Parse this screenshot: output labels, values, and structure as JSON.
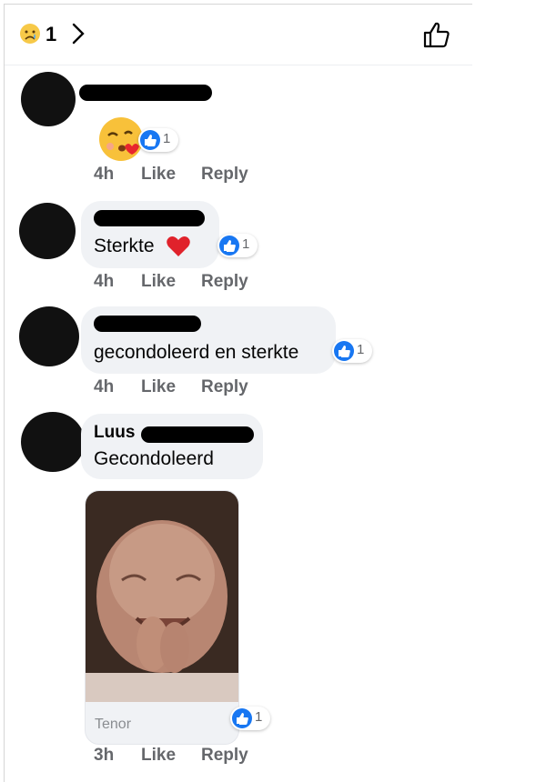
{
  "header": {
    "reaction_icon": "sad-face-icon",
    "reaction_count": "1",
    "chevron_icon": "chevron-right-icon",
    "like_icon": "thumbs-up-icon"
  },
  "comments": [
    {
      "name": "",
      "text": "",
      "sticker": "kissing-face-emoji",
      "like_count": "1",
      "time": "4h",
      "like": "Like",
      "reply": "Reply"
    },
    {
      "name": "",
      "text": "Sterkte",
      "emoji": "red-heart-emoji",
      "like_count": "1",
      "time": "4h",
      "like": "Like",
      "reply": "Reply"
    },
    {
      "name": "",
      "text": "gecondoleerd en sterkte",
      "like_count": "1",
      "time": "4h",
      "like": "Like",
      "reply": "Reply"
    },
    {
      "name": "Luus",
      "text": "Gecondoleerd",
      "gif_source": "Tenor",
      "like_count": "1",
      "time": "3h",
      "like": "Like",
      "reply": "Reply"
    }
  ],
  "colors": {
    "like_blue": "#1877f2",
    "bubble_gray": "#f0f2f5",
    "meta_gray": "#65676b"
  }
}
